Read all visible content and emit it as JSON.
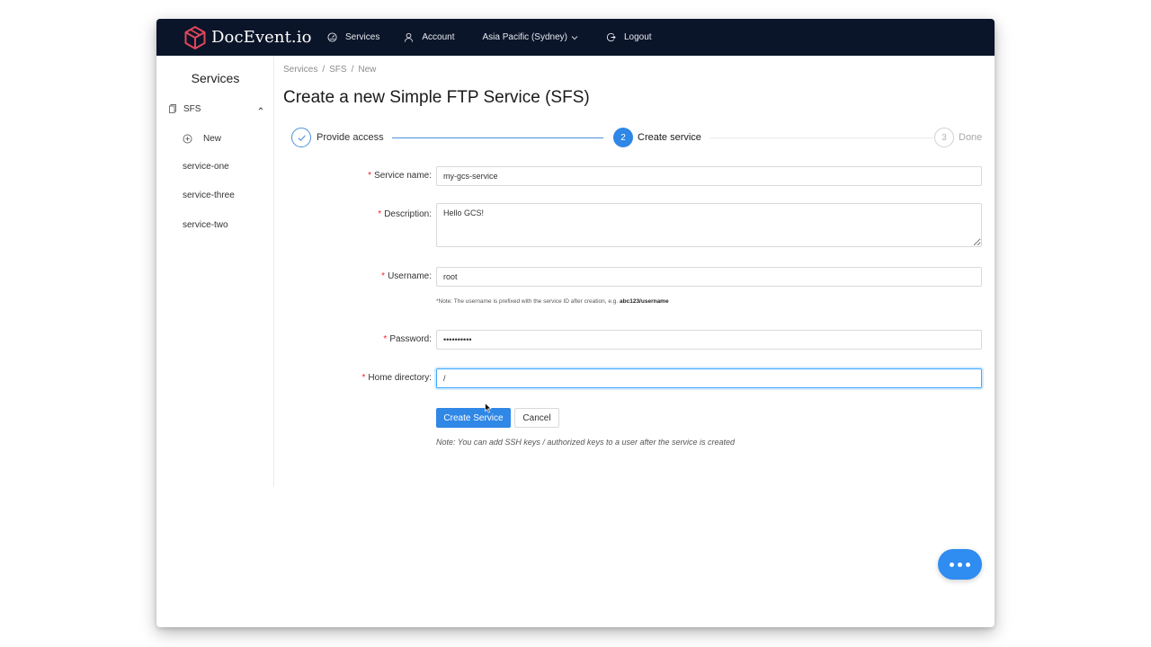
{
  "brand": {
    "name": "DocEvent.io"
  },
  "nav": {
    "services": "Services",
    "account": "Account",
    "region": "Asia Pacific (Sydney)",
    "logout": "Logout"
  },
  "sidebar": {
    "title": "Services",
    "group": {
      "label": "SFS",
      "expanded": true
    },
    "new_label": "New",
    "items": [
      {
        "label": "service-one"
      },
      {
        "label": "service-three"
      },
      {
        "label": "service-two"
      }
    ]
  },
  "breadcrumb": [
    "Services",
    "SFS",
    "New"
  ],
  "page_title": "Create a new Simple FTP Service (SFS)",
  "steps": [
    {
      "label": "Provide access",
      "status": "finished"
    },
    {
      "number": "2",
      "label": "Create service",
      "status": "current"
    },
    {
      "number": "3",
      "label": "Done",
      "status": "waiting"
    }
  ],
  "form": {
    "service_name": {
      "label": "Service name",
      "value": "my-gcs-service"
    },
    "description": {
      "label": "Description",
      "value": "Hello GCS!"
    },
    "username": {
      "label": "Username",
      "value": "root",
      "note_text": "*Note: The username is prefixed with the service ID after creation, e.g.",
      "note_example": "abc123/username"
    },
    "password": {
      "label": "Password",
      "value": "••••••••••"
    },
    "home_directory": {
      "label": "Home directory",
      "value": "/"
    },
    "separator": ":"
  },
  "actions": {
    "create_label": "Create Service",
    "cancel_label": "Cancel"
  },
  "footer_note": "Note: You can add SSH keys / authorized keys to a user after the service is created",
  "colors": {
    "topbar_bg": "#0b1529",
    "primary": "#2f87e6",
    "required": "#f5222d",
    "logo": "#e0475b"
  }
}
